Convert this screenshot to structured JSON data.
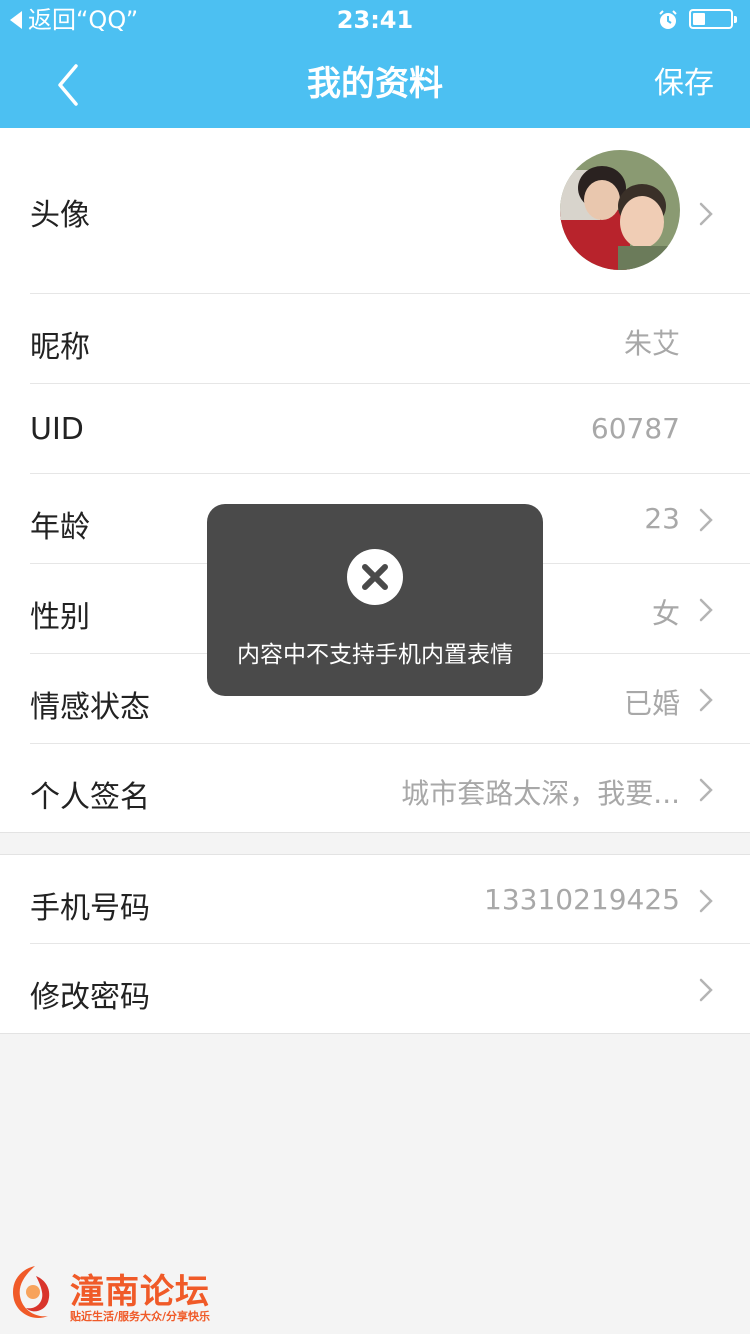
{
  "status_bar": {
    "back_app": "返回“QQ”",
    "time": "23:41"
  },
  "nav": {
    "title": "我的资料",
    "save": "保存"
  },
  "profile": {
    "avatar_label": "头像",
    "rows": [
      {
        "label": "昵称",
        "value": "朱艾"
      },
      {
        "label": "UID",
        "value": "60787"
      },
      {
        "label": "年龄",
        "value": "23"
      },
      {
        "label": "性别",
        "value": "女"
      },
      {
        "label": "情感状态",
        "value": "已婚"
      },
      {
        "label": "个人签名",
        "value": "城市套路太深，我要..."
      }
    ]
  },
  "account": {
    "rows": [
      {
        "label": "手机号码",
        "value": "13310219425"
      },
      {
        "label": "修改密码",
        "value": ""
      }
    ]
  },
  "toast": {
    "message": "内容中不支持手机内置表情"
  },
  "watermark": {
    "title": "潼南论坛",
    "subtitle": "贴近生活/服务大众/分享快乐"
  },
  "colors": {
    "header": "#4cc0f2",
    "toast_bg": "#4a4a4a",
    "watermark": "#f05a28"
  }
}
